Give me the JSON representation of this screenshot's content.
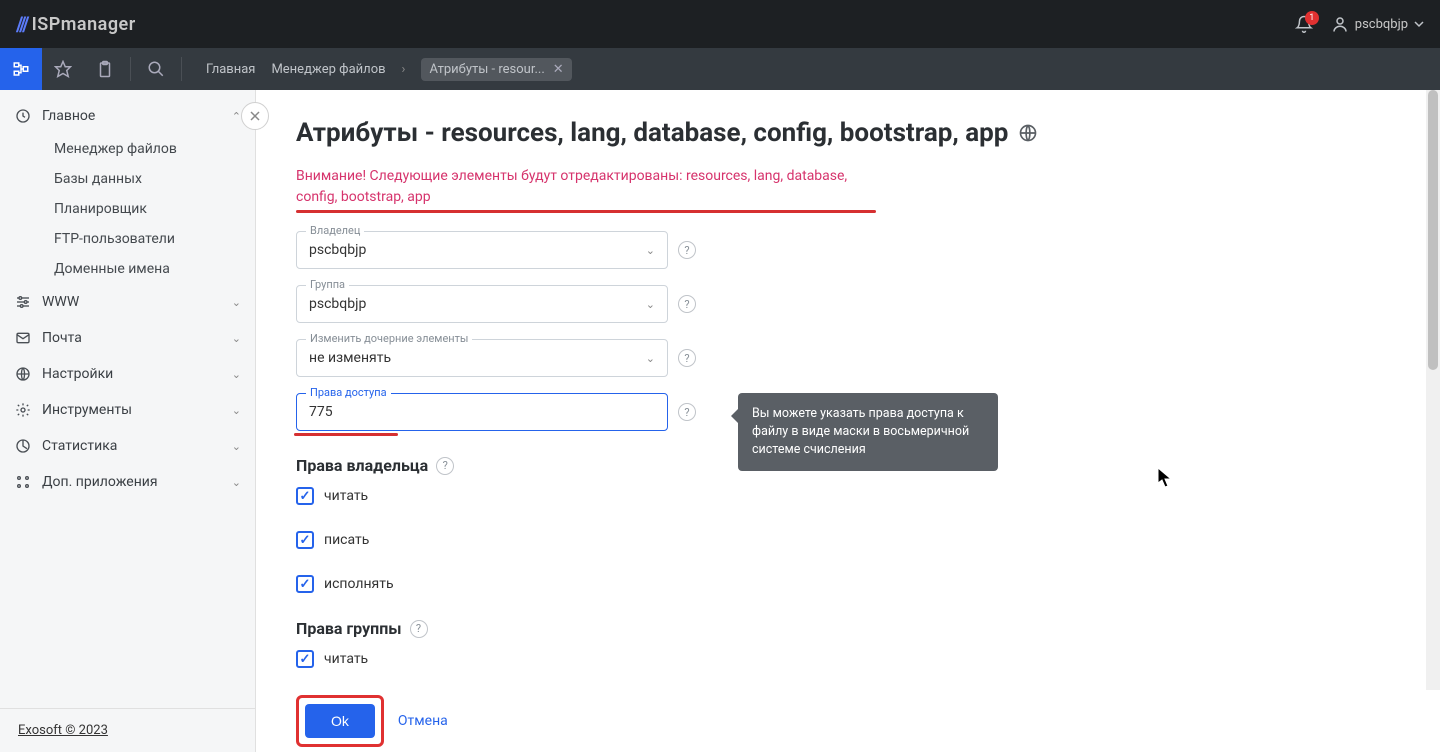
{
  "brand": {
    "slashes": "///",
    "name": "ISPmanager"
  },
  "topbar": {
    "bell_count": "1",
    "username": "pscbqbjp"
  },
  "breadcrumbs": {
    "home": "Главная",
    "fm": "Менеджер файлов",
    "tab": "Атрибуты - resour..."
  },
  "sidebar": {
    "main": {
      "label": "Главное",
      "items": [
        "Менеджер файлов",
        "Базы данных",
        "Планировщик",
        "FTP-пользователи",
        "Доменные имена"
      ]
    },
    "groups": [
      {
        "label": "WWW"
      },
      {
        "label": "Почта"
      },
      {
        "label": "Настройки"
      },
      {
        "label": "Инструменты"
      },
      {
        "label": "Статистика"
      },
      {
        "label": "Доп. приложения"
      }
    ],
    "footer": "Exosoft © 2023"
  },
  "page": {
    "title": "Атрибуты - resources, lang, database, config, bootstrap, app",
    "warning": "Внимание! Следующие элементы будут отредактированы: resources, lang, database, config, bootstrap, app",
    "fields": {
      "owner": {
        "label": "Владелец",
        "value": "pscbqbjp"
      },
      "group": {
        "label": "Группа",
        "value": "pscbqbjp"
      },
      "children": {
        "label": "Изменить дочерние элементы",
        "value": "не изменять"
      },
      "perms": {
        "label": "Права доступа",
        "value": "775"
      }
    },
    "tooltip": "Вы можете указать права доступа к файлу в виде маски в восьмеричной системе счисления",
    "owner_perms": {
      "title": "Права владельца",
      "read": "читать",
      "write": "писать",
      "exec": "исполнять"
    },
    "group_perms": {
      "title": "Права группы",
      "read": "читать"
    },
    "buttons": {
      "ok": "Ok",
      "cancel": "Отмена"
    }
  }
}
